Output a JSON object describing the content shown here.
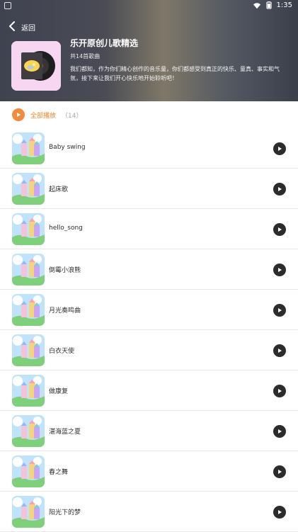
{
  "status": {
    "time": "1:35",
    "icons": [
      "wifi-icon",
      "battery-icon"
    ]
  },
  "header": {
    "back_label": "返回",
    "title": "乐开原创儿歌精选",
    "count_text": "共14首歌曲",
    "description": "我们都知，作为你们精心创作的音乐童，你们都感受到真正的快乐、童真、事实和气氛，接下来让我们开心快乐地开始聆听吧！"
  },
  "controls": {
    "play_all_label": "全部播放",
    "play_all_count": "（14）"
  },
  "songs": [
    {
      "title": "Baby swing"
    },
    {
      "title": "起床歌"
    },
    {
      "title": "hello_song"
    },
    {
      "title": "倒霉小浪熊"
    },
    {
      "title": "月光奏鸣曲"
    },
    {
      "title": "白衣天使"
    },
    {
      "title": "做康复"
    },
    {
      "title": "湛海蓝之夏"
    },
    {
      "title": "春之舞"
    },
    {
      "title": "阳光下的梦"
    }
  ],
  "colors": {
    "accent": "#f28b3d",
    "header_left": "#3f4250",
    "header_mid": "#7f7868",
    "row_divider": "#e9e9e9",
    "play_button": "#2c2c2c"
  }
}
